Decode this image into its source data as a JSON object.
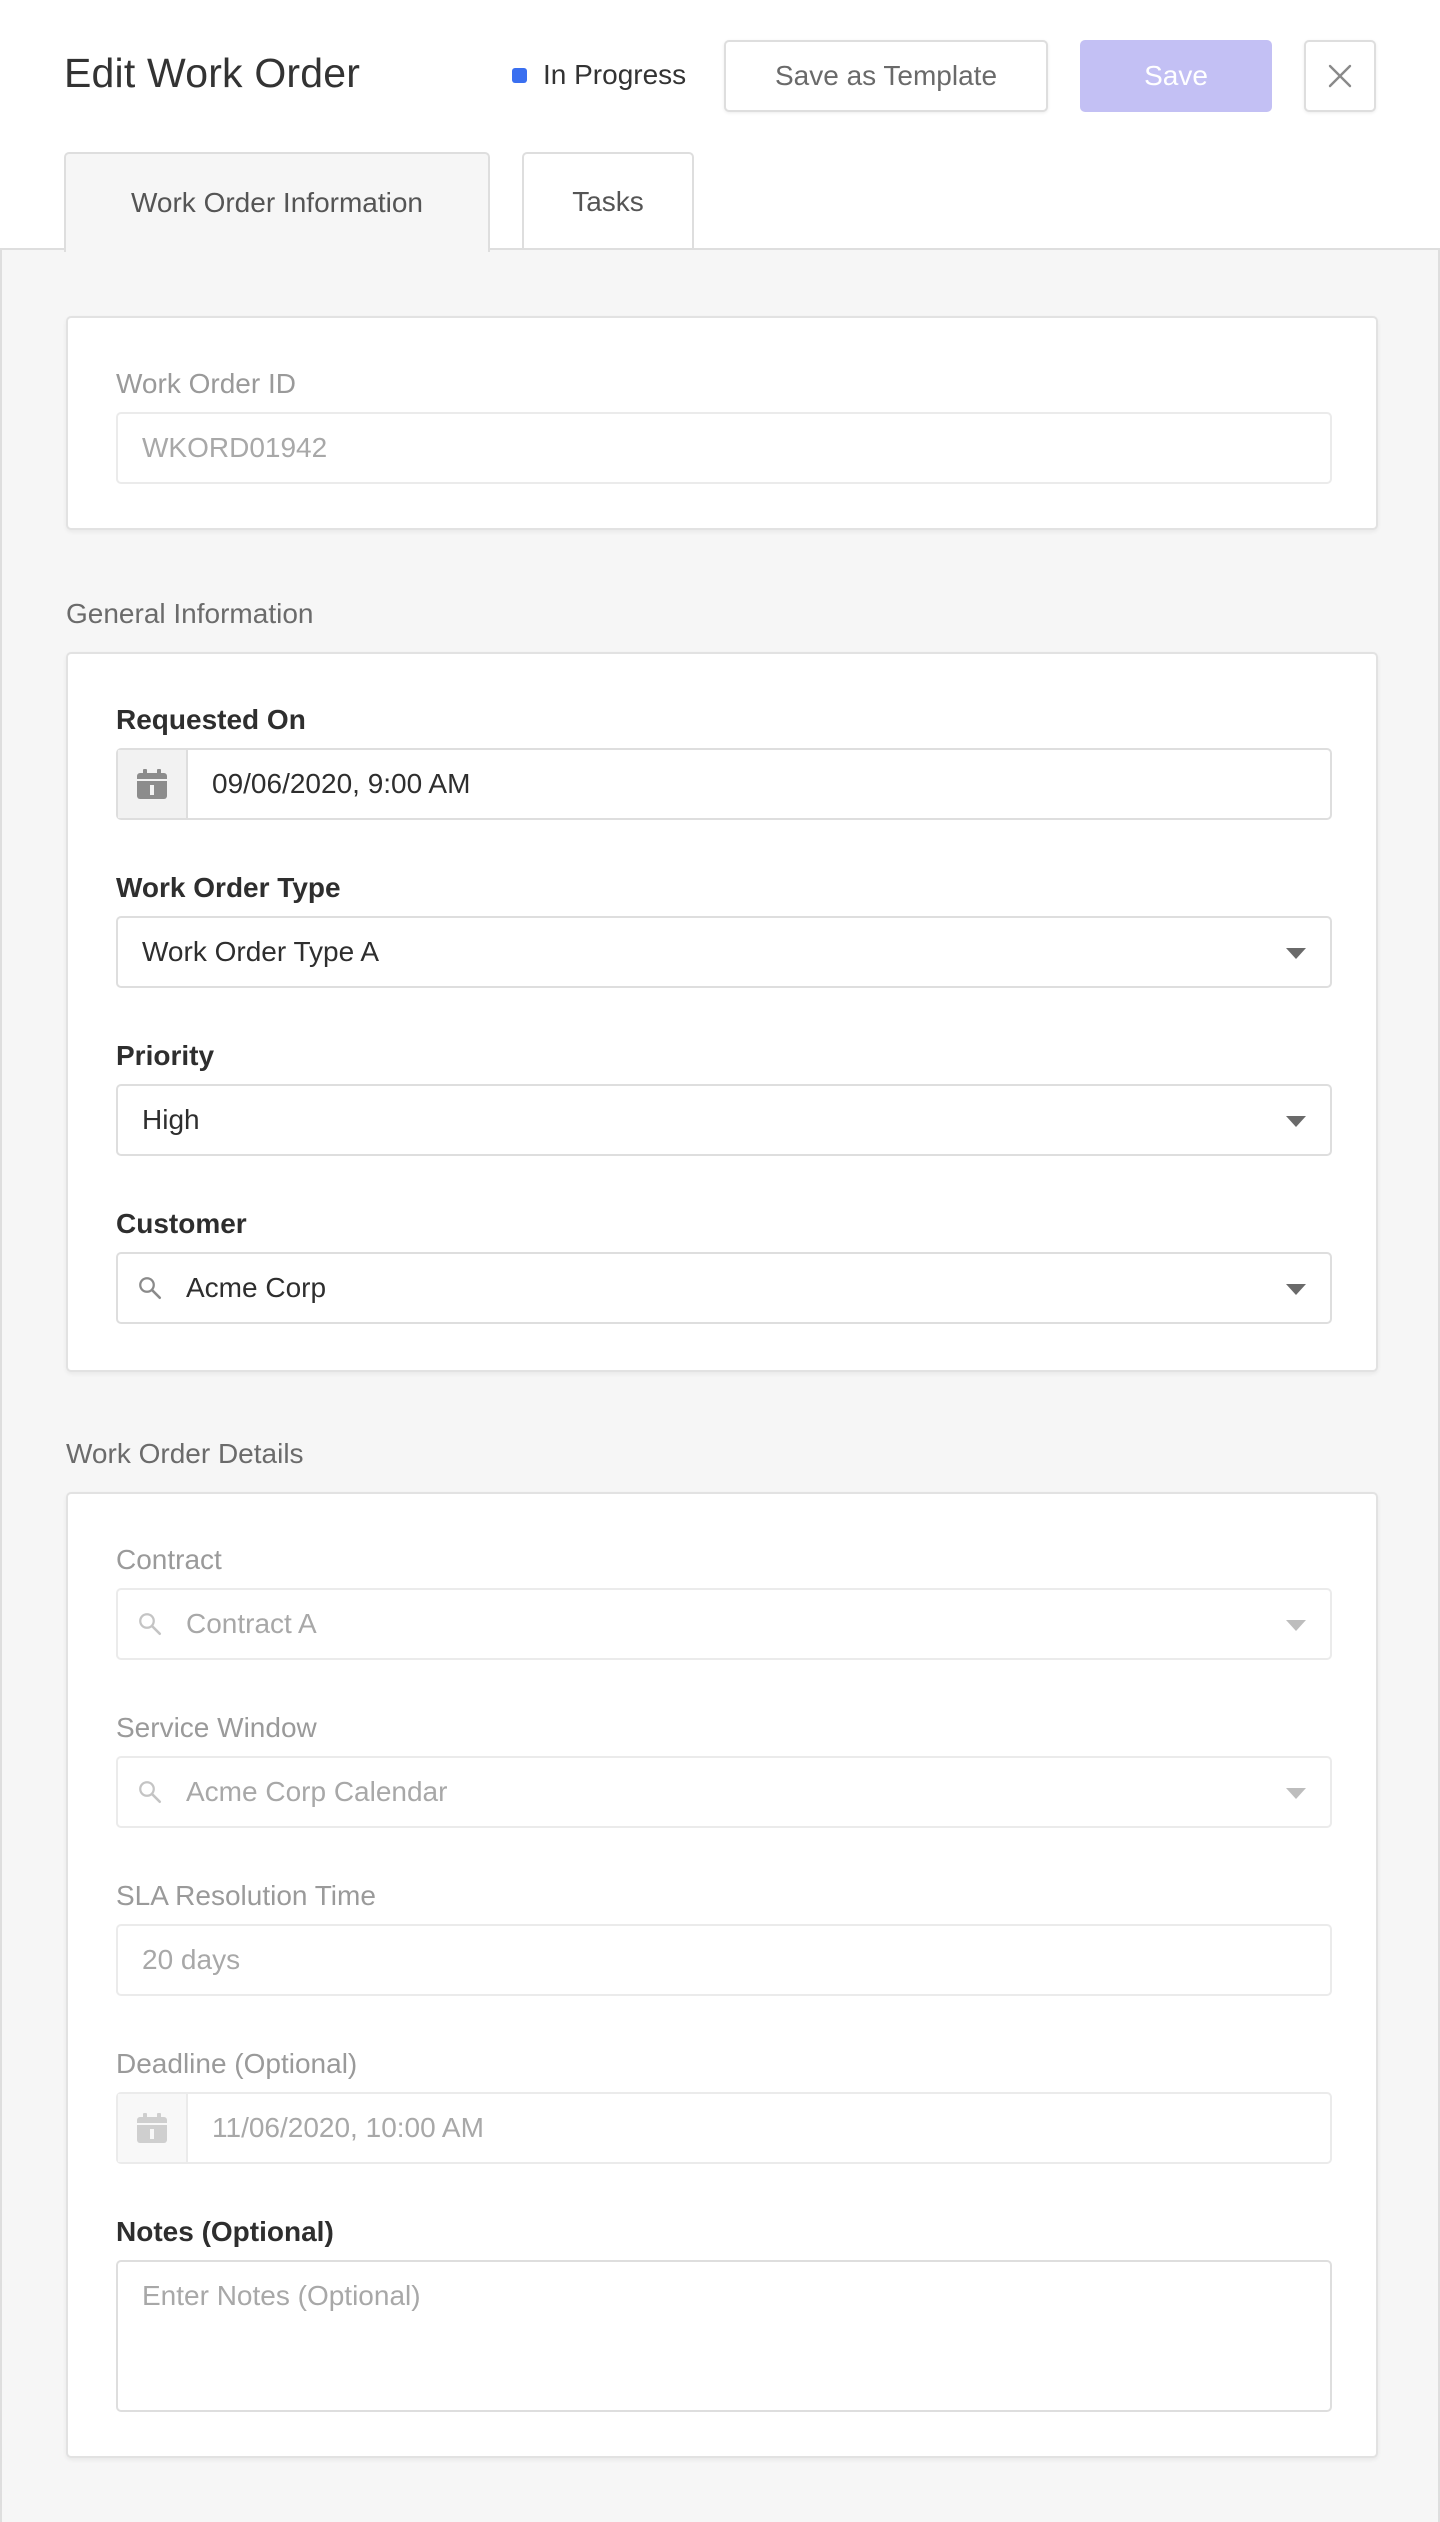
{
  "header": {
    "title": "Edit Work Order",
    "status": {
      "label": "In Progress",
      "color": "#3a6ff0"
    },
    "save_template_label": "Save as Template",
    "save_label": "Save",
    "close_icon": "close-icon"
  },
  "tabs": [
    {
      "label": "Work Order Information",
      "active": true
    },
    {
      "label": "Tasks",
      "active": false
    }
  ],
  "id_card": {
    "label": "Work Order ID",
    "value": "WKORD01942"
  },
  "general": {
    "heading": "General Information",
    "requested_on": {
      "label": "Requested On",
      "value": "09/06/2020, 9:00 AM",
      "icon": "calendar-icon"
    },
    "work_order_type": {
      "label": "Work Order Type",
      "value": "Work Order Type A"
    },
    "priority": {
      "label": "Priority",
      "value": "High"
    },
    "customer": {
      "label": "Customer",
      "value": "Acme Corp",
      "icon": "search-icon"
    }
  },
  "details": {
    "heading": "Work Order Details",
    "contract": {
      "label": "Contract",
      "value": "Contract A",
      "icon": "search-icon"
    },
    "service_window": {
      "label": "Service Window",
      "value": "Acme Corp Calendar",
      "icon": "search-icon"
    },
    "sla": {
      "label": "SLA Resolution Time",
      "value": "20 days"
    },
    "deadline": {
      "label": "Deadline (Optional)",
      "value": "11/06/2020, 10:00 AM",
      "icon": "calendar-icon"
    },
    "notes": {
      "label": "Notes (Optional)",
      "placeholder": "Enter Notes (Optional)"
    }
  },
  "colors": {
    "accent_disabled": "#c3c0f4",
    "status_blue": "#3a6ff0",
    "page_bg": "#f6f6f6"
  }
}
